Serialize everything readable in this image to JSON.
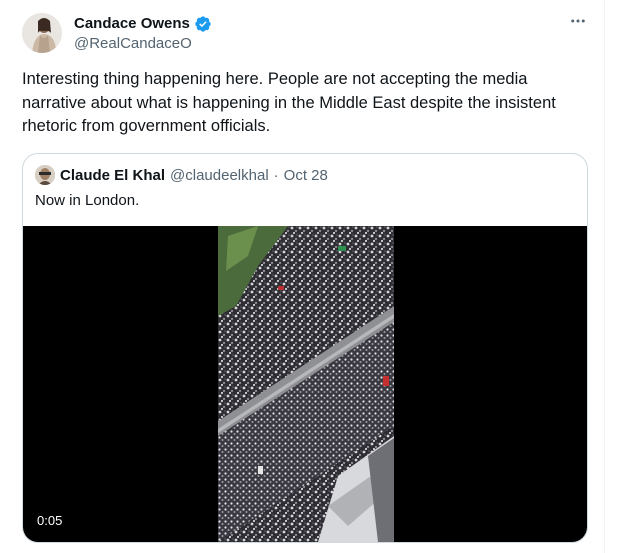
{
  "tweet": {
    "author": {
      "name": "Candace Owens",
      "handle": "@RealCandaceO",
      "verified": true
    },
    "more_icon": "more-horizontal-icon",
    "text": "Interesting thing happening here. People are not accepting the media narrative about what is happening in the Middle East despite the insistent rhetoric from government officials."
  },
  "quote": {
    "author": {
      "name": "Claude El Khal",
      "handle": "@claudeelkhal",
      "separator": "·",
      "date": "Oct 28"
    },
    "text": "Now in London.",
    "video": {
      "duration": "0:05"
    }
  },
  "colors": {
    "text": "#0f1419",
    "secondary": "#536471",
    "verified": "#1d9bf0",
    "border": "#cfd9de"
  }
}
